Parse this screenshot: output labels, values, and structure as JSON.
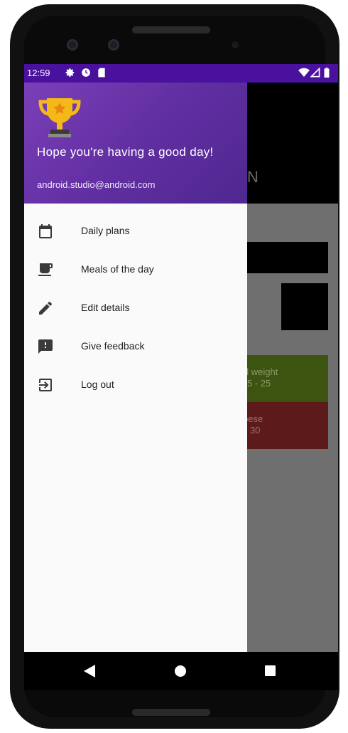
{
  "status_bar": {
    "time": "12:59",
    "icons": [
      "gear-icon",
      "circle-icon",
      "sd-card-icon",
      "wifi-icon",
      "signal-icon",
      "battery-icon"
    ]
  },
  "background_app": {
    "header_text": "N",
    "bmi_rows": [
      {
        "line1": "al weight",
        "line2": "5 - 25"
      },
      {
        "line1": "bese",
        "line2": "- 30"
      }
    ]
  },
  "drawer": {
    "header": {
      "icon": "trophy-icon",
      "greeting": "Hope you're having a good day!",
      "email": "android.studio@android.com"
    },
    "items": [
      {
        "label": "Daily plans",
        "icon": "calendar-icon"
      },
      {
        "label": "Meals of the day",
        "icon": "meal-icon"
      },
      {
        "label": "Edit details",
        "icon": "pencil-icon"
      },
      {
        "label": "Give feedback",
        "icon": "feedback-icon"
      },
      {
        "label": "Log out",
        "icon": "logout-icon"
      }
    ]
  },
  "colors": {
    "status_bar": "#4a119f",
    "drawer_header": "#6a34ad",
    "bmi_green": "#3c5410",
    "bmi_red": "#5c1a1a"
  }
}
